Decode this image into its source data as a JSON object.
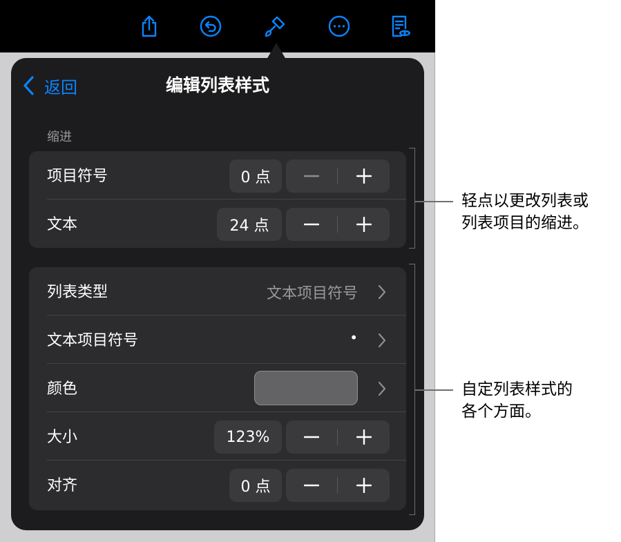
{
  "toolbar": {
    "icons": [
      "share-icon",
      "undo-icon",
      "paintbrush-icon",
      "more-icon",
      "reader-view-icon"
    ],
    "accent": "#0a84ff"
  },
  "popover": {
    "back_label": "返回",
    "title": "编辑列表样式",
    "indent_section_label": "缩进",
    "indent_rows": [
      {
        "label": "项目符号",
        "value": "0 点"
      },
      {
        "label": "文本",
        "value": "24 点"
      }
    ],
    "style_rows": {
      "list_type": {
        "label": "列表类型",
        "value": "文本项目符号"
      },
      "text_bullet": {
        "label": "文本项目符号",
        "value": "•"
      },
      "color": {
        "label": "颜色",
        "swatch": "#636366"
      },
      "size": {
        "label": "大小",
        "value": "123%"
      },
      "align": {
        "label": "对齐",
        "value": "0 点"
      }
    }
  },
  "callouts": {
    "indent": [
      "轻点以更改列表或",
      "列表项目的缩进。"
    ],
    "style": [
      "自定列表样式的",
      "各个方面。"
    ]
  }
}
